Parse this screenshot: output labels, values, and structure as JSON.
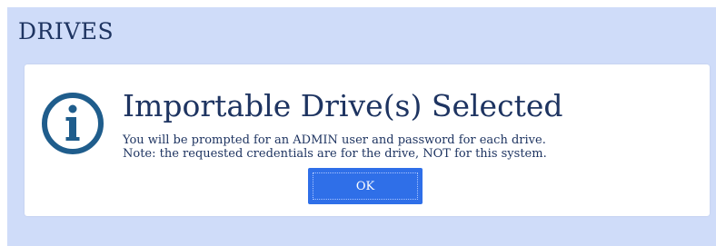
{
  "panel": {
    "title": "DRIVES"
  },
  "dialog": {
    "icon": "info-icon",
    "heading": "Importable Drive(s) Selected",
    "message_lines": [
      "You will be prompted for an ADMIN user and password for each drive.",
      "Note: the requested credentials are for the drive, NOT for this system."
    ],
    "ok_label": "OK"
  },
  "colors": {
    "panel_background": "#cfdcf9",
    "text": "#1e3461",
    "icon": "#1f5d8c",
    "button": "#2f6fe8"
  }
}
